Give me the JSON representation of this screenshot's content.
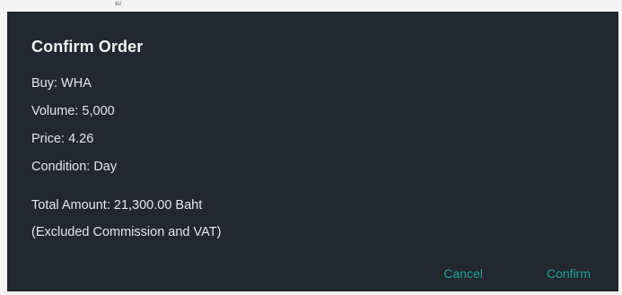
{
  "top_glyph": "ฒ",
  "dialog": {
    "title": "Confirm Order",
    "lines": {
      "buy": "Buy: WHA",
      "volume": "Volume: 5,000",
      "price": "Price: 4.26",
      "condition": "Condition: Day",
      "total": "Total Amount: 21,300.00 Baht",
      "excluded": "(Excluded Commission and VAT)"
    },
    "actions": {
      "cancel": "Cancel",
      "confirm": "Confirm"
    }
  },
  "colors": {
    "background": "#f4f4f4",
    "dialog_background": "#23272f",
    "title_text": "#f2f2f2",
    "body_text": "#e4e6ea",
    "accent": "#1aa29a"
  }
}
